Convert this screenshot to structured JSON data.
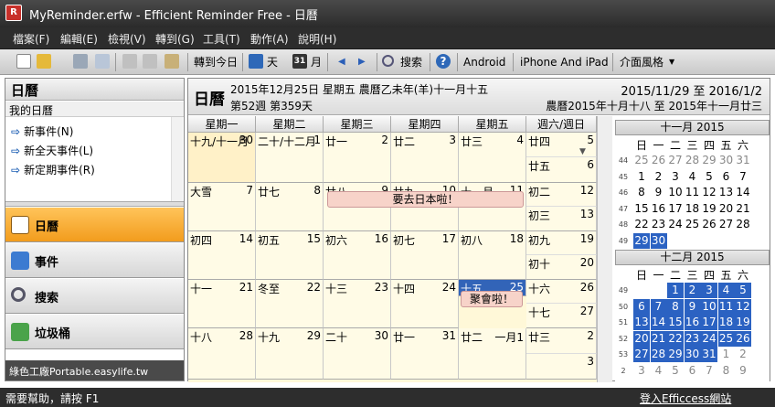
{
  "window": {
    "title": "MyReminder.erfw - Efficient Reminder Free - 日曆",
    "icon_letter": "R"
  },
  "menu": [
    "檔案(F)",
    "編輯(E)",
    "檢視(V)",
    "轉到(G)",
    "工具(T)",
    "動作(A)",
    "說明(H)"
  ],
  "toolbar": {
    "goto_today": "轉到今日",
    "day": "天",
    "month": "月",
    "month_icon_num": "31",
    "search": "搜索",
    "android": "Android",
    "iphone": "iPhone And iPad",
    "style": "介面風格"
  },
  "sidebar": {
    "title": "日曆",
    "my_calendar": "我的日曆",
    "quick": [
      "新事件(N)",
      "新全天事件(L)",
      "新定期事件(R)"
    ],
    "nav": [
      "日曆",
      "事件",
      "搜索",
      "垃圾桶"
    ],
    "footer": "綠色工廠Portable.easylife.tw"
  },
  "header": {
    "title": "日曆",
    "date_line": "2015年12月25日 星期五 農曆乙未年(羊)十一月十五",
    "week_line": "第52週 第359天",
    "range": "2015/11/29 至 2016/1/2",
    "lunar_range": "農曆2015年十月十八 至 2015年十一月廿三"
  },
  "weekdays": [
    "星期一",
    "星期二",
    "星期三",
    "星期四",
    "星期五",
    "週六/週日"
  ],
  "weeks": [
    {
      "days": [
        [
          "十九/十一月",
          "30"
        ],
        [
          "二十/十二月",
          "1"
        ],
        [
          "廿一",
          "2"
        ],
        [
          "廿二",
          "3"
        ],
        [
          "廿三",
          "4"
        ]
      ],
      "sat": [
        "廿四",
        "5"
      ],
      "sun": [
        "廿五",
        "6"
      ]
    },
    {
      "days": [
        [
          "大雪",
          "7"
        ],
        [
          "廿七",
          "8"
        ],
        [
          "廿八",
          "9"
        ],
        [
          "廿九",
          "10"
        ],
        [
          "十一月",
          "11"
        ]
      ],
      "sat": [
        "初二",
        "12"
      ],
      "sun": [
        "初三",
        "13"
      ]
    },
    {
      "days": [
        [
          "初四",
          "14"
        ],
        [
          "初五",
          "15"
        ],
        [
          "初六",
          "16"
        ],
        [
          "初七",
          "17"
        ],
        [
          "初八",
          "18"
        ]
      ],
      "sat": [
        "初九",
        "19"
      ],
      "sun": [
        "初十",
        "20"
      ]
    },
    {
      "days": [
        [
          "十一",
          "21"
        ],
        [
          "冬至",
          "22"
        ],
        [
          "十三",
          "23"
        ],
        [
          "十四",
          "24"
        ],
        [
          "十五",
          "25"
        ]
      ],
      "sat": [
        "十六",
        "26"
      ],
      "sun": [
        "十七",
        "27"
      ]
    },
    {
      "days": [
        [
          "十八",
          "28"
        ],
        [
          "十九",
          "29"
        ],
        [
          "二十",
          "30"
        ],
        [
          "廿一",
          "31"
        ],
        [
          "廿二",
          "一月1"
        ]
      ],
      "sat": [
        "廿三",
        "2"
      ],
      "sun": [
        "",
        "3"
      ]
    }
  ],
  "events": [
    {
      "label": "要去日本啦！"
    },
    {
      "label": "聚會啦！"
    }
  ],
  "mini_nov": {
    "title": "十一月 2015",
    "dow": [
      "日",
      "一",
      "二",
      "三",
      "四",
      "五",
      "六"
    ],
    "rows": [
      [
        "44",
        "25",
        "26",
        "27",
        "28",
        "29",
        "30",
        "31"
      ],
      [
        "45",
        "1",
        "2",
        "3",
        "4",
        "5",
        "6",
        "7"
      ],
      [
        "46",
        "8",
        "9",
        "10",
        "11",
        "12",
        "13",
        "14"
      ],
      [
        "47",
        "15",
        "16",
        "17",
        "18",
        "19",
        "20",
        "21"
      ],
      [
        "48",
        "22",
        "23",
        "24",
        "25",
        "26",
        "27",
        "28"
      ],
      [
        "49",
        "29",
        "30",
        "",
        "",
        "",
        "",
        ""
      ]
    ]
  },
  "mini_dec": {
    "title": "十二月 2015",
    "dow": [
      "日",
      "一",
      "二",
      "三",
      "四",
      "五",
      "六"
    ],
    "rows": [
      [
        "49",
        "",
        "",
        "1",
        "2",
        "3",
        "4",
        "5"
      ],
      [
        "50",
        "6",
        "7",
        "8",
        "9",
        "10",
        "11",
        "12"
      ],
      [
        "51",
        "13",
        "14",
        "15",
        "16",
        "17",
        "18",
        "19"
      ],
      [
        "52",
        "20",
        "21",
        "22",
        "23",
        "24",
        "25",
        "26"
      ],
      [
        "53",
        "27",
        "28",
        "29",
        "30",
        "31",
        "1",
        "2"
      ],
      [
        "2",
        "3",
        "4",
        "5",
        "6",
        "7",
        "8",
        "9"
      ]
    ]
  },
  "status": {
    "help": "需要幫助，請按 F1",
    "link": "登入Efficcess網站"
  }
}
